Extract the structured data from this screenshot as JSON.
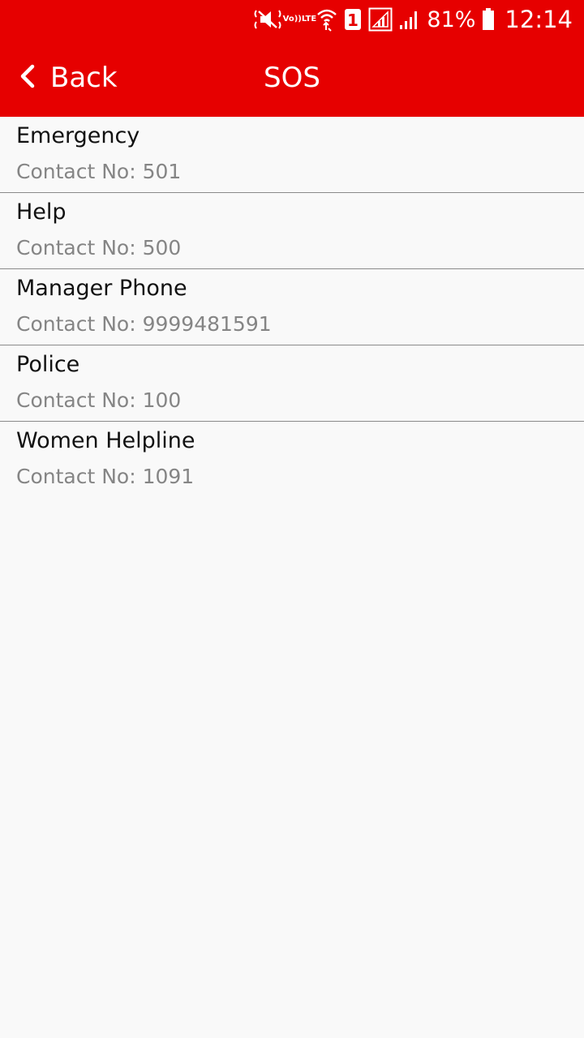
{
  "status_bar": {
    "lte_top": "Vo))",
    "lte_bottom": "LTE",
    "sim_number": "1",
    "battery_percent": "81%",
    "time": "12:14"
  },
  "app_bar": {
    "back_label": "Back",
    "title": "SOS",
    "color": "#e60000"
  },
  "contacts": [
    {
      "name": "Emergency",
      "contact": "Contact No: 501"
    },
    {
      "name": "Help",
      "contact": "Contact No: 500"
    },
    {
      "name": "Manager Phone",
      "contact": "Contact No: 9999481591"
    },
    {
      "name": "Police",
      "contact": "Contact No: 100"
    },
    {
      "name": "Women Helpline",
      "contact": "Contact No: 1091"
    }
  ]
}
